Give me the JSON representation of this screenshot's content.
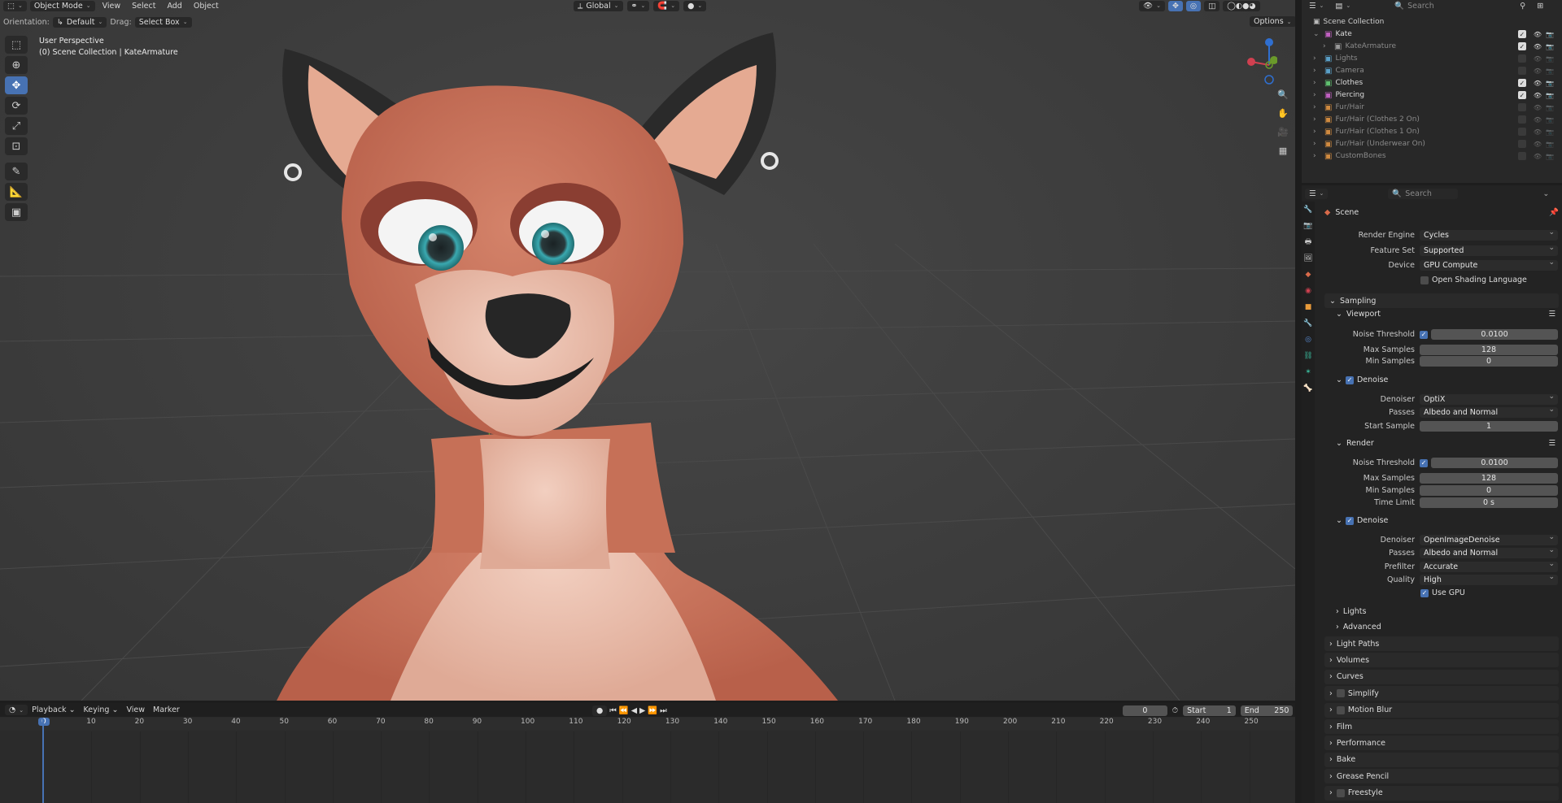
{
  "viewport": {
    "mode": "Object Mode",
    "menus": [
      "View",
      "Select",
      "Add",
      "Object"
    ],
    "transform_orientation": "Global",
    "orientation_label": "Orientation:",
    "orientation_value": "Default",
    "drag_label": "Drag:",
    "drag_value": "Select Box",
    "options": "Options",
    "search_placeholder": "Search",
    "overlay_title": "User Perspective",
    "overlay_subtitle": "(0) Scene Collection | KateArmature",
    "gizmo": {
      "z": "Z",
      "y": "Y",
      "x": "X"
    }
  },
  "outliner": {
    "search_placeholder": "Search",
    "root": "Scene Collection",
    "items": [
      {
        "name": "Kate",
        "level": 0,
        "expanded": true,
        "enabled": true,
        "color": "#c060c0"
      },
      {
        "name": "KateArmature",
        "level": 1,
        "enabled": true,
        "dim": true,
        "color": "#999999"
      },
      {
        "name": "Lights",
        "level": 0,
        "enabled": false,
        "dim": true,
        "color": "#5aa0c8"
      },
      {
        "name": "Camera",
        "level": 0,
        "enabled": false,
        "dim": true,
        "color": "#5aa0c8"
      },
      {
        "name": "Clothes",
        "level": 0,
        "enabled": true,
        "color": "#60c070"
      },
      {
        "name": "Piercing",
        "level": 0,
        "enabled": true,
        "color": "#c060c0"
      },
      {
        "name": "Fur/Hair",
        "level": 0,
        "enabled": false,
        "dim": true,
        "color": "#d08a40"
      },
      {
        "name": "Fur/Hair (Clothes 2 On)",
        "level": 0,
        "enabled": false,
        "dim": true,
        "color": "#d08a40"
      },
      {
        "name": "Fur/Hair (Clothes 1 On)",
        "level": 0,
        "enabled": false,
        "dim": true,
        "color": "#d08a40"
      },
      {
        "name": "Fur/Hair (Underwear On)",
        "level": 0,
        "enabled": false,
        "dim": true,
        "color": "#d08a40"
      },
      {
        "name": "CustomBones",
        "level": 0,
        "enabled": false,
        "dim": true,
        "color": "#d08a40"
      }
    ]
  },
  "properties": {
    "search_placeholder": "Search",
    "context": "Scene",
    "render_engine_label": "Render Engine",
    "render_engine": "Cycles",
    "feature_set_label": "Feature Set",
    "feature_set": "Supported",
    "device_label": "Device",
    "device": "GPU Compute",
    "osl_label": "Open Shading Language",
    "sampling": "Sampling",
    "viewport_sub": "Viewport",
    "noise_threshold_label": "Noise Threshold",
    "vp_noise_threshold": "0.0100",
    "max_samples_label": "Max Samples",
    "vp_max_samples": "128",
    "min_samples_label": "Min Samples",
    "vp_min_samples": "0",
    "denoise_label": "Denoise",
    "denoiser_label": "Denoiser",
    "vp_denoiser": "OptiX",
    "passes_label": "Passes",
    "vp_passes": "Albedo and Normal",
    "start_sample_label": "Start Sample",
    "vp_start_sample": "1",
    "render_sub": "Render",
    "r_noise_threshold": "0.0100",
    "r_max_samples": "128",
    "r_min_samples": "0",
    "time_limit_label": "Time Limit",
    "r_time_limit": "0 s",
    "r_denoiser": "OpenImageDenoise",
    "r_passes": "Albedo and Normal",
    "prefilter_label": "Prefilter",
    "r_prefilter": "Accurate",
    "quality_label": "Quality",
    "r_quality": "High",
    "use_gpu_label": "Use GPU",
    "lights_sub": "Lights",
    "advanced_sub": "Advanced",
    "panels": [
      "Light Paths",
      "Volumes",
      "Curves",
      "Simplify",
      "Motion Blur",
      "Film",
      "Performance",
      "Bake",
      "Grease Pencil",
      "Freestyle"
    ]
  },
  "timeline": {
    "menus": [
      "Playback",
      "Keying",
      "View",
      "Marker"
    ],
    "current_frame": "0",
    "start_label": "Start",
    "start": "1",
    "end_label": "End",
    "end": "250",
    "ticks": [
      "0",
      "10",
      "20",
      "30",
      "40",
      "50",
      "60",
      "70",
      "80",
      "90",
      "100",
      "110",
      "120",
      "130",
      "140",
      "150",
      "160",
      "170",
      "180",
      "190",
      "200",
      "210",
      "220",
      "230",
      "240",
      "250"
    ]
  }
}
